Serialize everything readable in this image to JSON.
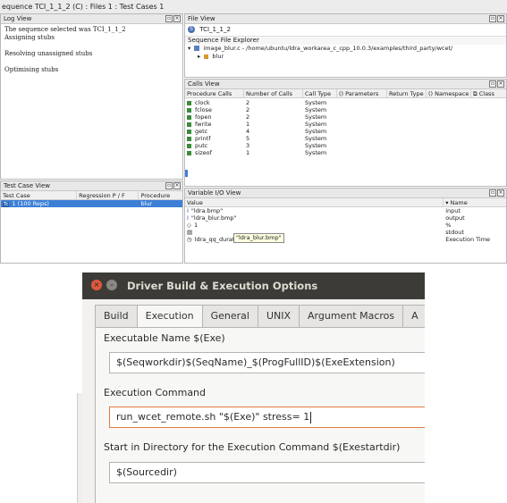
{
  "window_title": "equence TCI_1_1_2 (C) : Files 1 : Test Cases 1",
  "log_view": {
    "title": "Log View",
    "lines": [
      "The sequence selected was TCI_1_1_2",
      "Assigning stubs",
      "",
      "Resolving unassigned stubs",
      "",
      "Optimising stubs"
    ]
  },
  "file_view": {
    "title": "File View",
    "sequence_name": "TCI_1_1_2",
    "explorer_title": "Sequence File Explorer",
    "file_node": "image_blur.c - /home/ubuntu/ldra_workarea_c_cpp_10.0.3/examples/third_party/wcet/",
    "function_node": "blur"
  },
  "calls_view": {
    "title": "Calls View",
    "columns": [
      "Procedure Calls",
      "Number of Calls",
      "Call Type",
      "Parameters",
      "Return Type",
      "Namespace",
      "Class"
    ],
    "rows": [
      {
        "name": "clock",
        "count": "2",
        "type": "System"
      },
      {
        "name": "fclose",
        "count": "2",
        "type": "System"
      },
      {
        "name": "fopen",
        "count": "2",
        "type": "System"
      },
      {
        "name": "fwrite",
        "count": "1",
        "type": "System"
      },
      {
        "name": "getc",
        "count": "4",
        "type": "System"
      },
      {
        "name": "printf",
        "count": "5",
        "type": "System"
      },
      {
        "name": "putc",
        "count": "3",
        "type": "System"
      },
      {
        "name": "sizeof",
        "count": "1",
        "type": "System"
      }
    ]
  },
  "test_case_view": {
    "title": "Test Case View",
    "columns": [
      "Test Case",
      "Regression P / F",
      "Procedure"
    ],
    "rows": [
      {
        "case": "1 (100 Reps)",
        "regression": "",
        "procedure": "blur",
        "badge": "Tc"
      }
    ]
  },
  "variable_io_view": {
    "title": "Variable I/O View",
    "columns": [
      "Value",
      "Name"
    ],
    "rows": [
      {
        "value": "\"ldra.bmp\"",
        "name": "input",
        "marker": "I"
      },
      {
        "value": "\"ldra_blur.bmp\"",
        "name": "output",
        "marker": "I"
      },
      {
        "value": "1",
        "name": "%",
        "marker": "◇"
      },
      {
        "value": "",
        "name": "stdout",
        "marker": "▤"
      },
      {
        "value": "ldra_qq_duration",
        "name": "Execution Time",
        "marker": "◷"
      }
    ],
    "tooltip": "\"ldra_blur.bmp\""
  },
  "dialog": {
    "title": "Driver Build & Execution Options",
    "window_buttons": [
      "×",
      "–"
    ],
    "tabs": [
      "Build",
      "Execution",
      "General",
      "UNIX",
      "Argument Macros",
      "A"
    ],
    "active_tab": "Execution",
    "executable_label": "Executable Name $(Exe)",
    "executable_value": "$(Seqworkdir)$(SeqName)_$(ProgFullID)$(ExeExtension)",
    "command_label": "Execution Command",
    "command_value": "run_wcet_remote.sh \"$(Exe)\" stress= 1",
    "startdir_label": "Start in Directory for the Execution Command $(Exestartdir)",
    "startdir_value": "$(Sourcedir)"
  },
  "colors": {
    "title_bar": "#3c3b37",
    "close_button": "#e2573a",
    "focus_border": "#e07c3e",
    "selection": "#3d7fd6",
    "call_icon": "#3a8b3a"
  }
}
